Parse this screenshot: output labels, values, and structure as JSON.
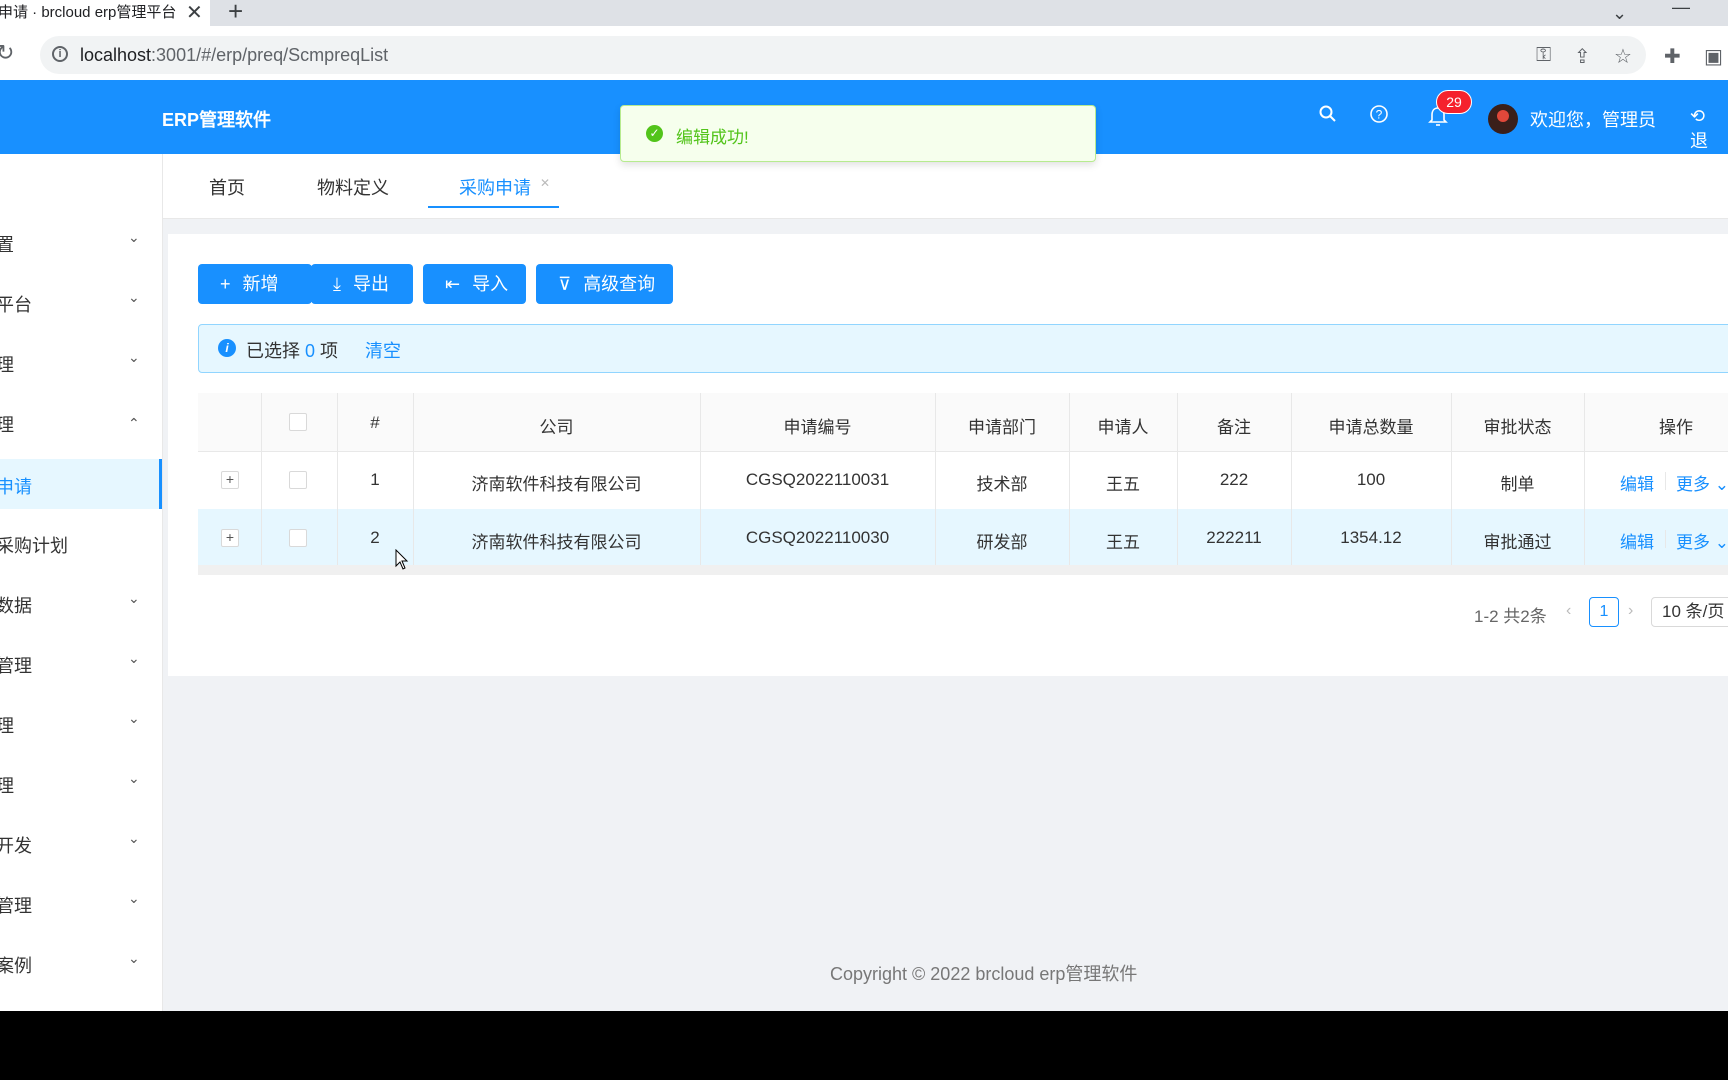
{
  "browser": {
    "tab_title": "申请 · brcloud erp管理平台",
    "tab_close": "✕",
    "new_tab": "+",
    "url_host": "localhost",
    "url_path": ":3001/#/erp/preq/ScmpreqList"
  },
  "header": {
    "app_title": "ERP管理软件",
    "notification_count": "29",
    "welcome": "欢迎您，管理员",
    "logout": "退"
  },
  "toast": {
    "message": "编辑成功!"
  },
  "sidebar": {
    "items": [
      {
        "label": "置",
        "chevron": "down"
      },
      {
        "label": "平台",
        "chevron": "down"
      },
      {
        "label": "理",
        "chevron": "down"
      },
      {
        "label": "理",
        "chevron": "up"
      },
      {
        "label": "申请",
        "active": true
      },
      {
        "label": "采购计划"
      },
      {
        "label": "数据",
        "chevron": "down"
      },
      {
        "label": "管理",
        "chevron": "down"
      },
      {
        "label": "理",
        "chevron": "down"
      },
      {
        "label": "理",
        "chevron": "down"
      },
      {
        "label": "开发",
        "chevron": "down"
      },
      {
        "label": "管理",
        "chevron": "down"
      },
      {
        "label": "案例",
        "chevron": "down"
      }
    ]
  },
  "page_tabs": [
    "首页",
    "物料定义",
    "采购申请"
  ],
  "toolbar": {
    "add": "新增",
    "export": "导出",
    "import": "导入",
    "advanced": "高级查询"
  },
  "selection": {
    "prefix": "已选择",
    "count": "0",
    "suffix": "项",
    "clear": "清空"
  },
  "table": {
    "columns": [
      "#",
      "公司",
      "申请编号",
      "申请部门",
      "申请人",
      "备注",
      "申请总数量",
      "审批状态",
      "操作"
    ],
    "rows": [
      {
        "idx": "1",
        "company": "济南软件科技有限公司",
        "code": "CGSQ2022110031",
        "dept": "技术部",
        "person": "王五",
        "remark": "222",
        "qty": "100",
        "status": "制单",
        "edit": "编辑",
        "more": "更多"
      },
      {
        "idx": "2",
        "company": "济南软件科技有限公司",
        "code": "CGSQ2022110030",
        "dept": "研发部",
        "person": "王五",
        "remark": "222211",
        "qty": "1354.12",
        "status": "审批通过",
        "edit": "编辑",
        "more": "更多"
      }
    ]
  },
  "pagination": {
    "total": "1-2 共2条",
    "current": "1",
    "page_size": "10 条/页"
  },
  "footer": {
    "copyright": "Copyright © 2022 brcloud erp管理软件"
  },
  "colors": {
    "primary": "#1890ff",
    "success": "#52c41a",
    "badge": "#f5222d"
  }
}
